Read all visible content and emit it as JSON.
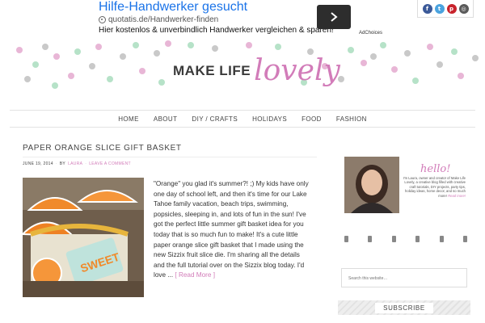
{
  "ad": {
    "title": "Hilfe-Handwerker gesucht",
    "url": "quotatis.de/Handwerker-finden",
    "description": "Hier kostenlos & unverbindlich Handwerker vergleichen & sparen!",
    "adchoices": "AdChoices"
  },
  "social": [
    {
      "icon": "facebook-icon",
      "glyph": "f",
      "color": "#3b5998"
    },
    {
      "icon": "twitter-icon",
      "glyph": "t",
      "color": "#4aa3df"
    },
    {
      "icon": "pinterest-icon",
      "glyph": "p",
      "color": "#c8232c"
    },
    {
      "icon": "instagram-icon",
      "glyph": "◎",
      "color": "#5a5a5a"
    }
  ],
  "logo": {
    "part1": "MAKE LIFE",
    "part2": "lovely"
  },
  "nav": [
    "HOME",
    "ABOUT",
    "DIY / CRAFTS",
    "HOLIDAYS",
    "FOOD",
    "FASHION"
  ],
  "post": {
    "title": "PAPER ORANGE SLICE GIFT BASKET",
    "date": "JUNE 19, 2014",
    "by": "BY",
    "author": "LAURA",
    "comment": "LEAVE A COMMENT",
    "body": "\"Orange\" you glad it's summer?!  ;)  My kids have only one day of school left, and then it's time for our Lake Tahoe family vacation, beach trips, swimming, popsicles, sleeping in, and lots of fun in the sun! I've got the perfect little summer gift basket idea for you today that is so much fun to make!  It's a cute little paper orange slice gift basket that I made using the new Sizzix fruit slice die. I'm sharing all the details and the full tutorial over on the Sizzix blog today.  I'd love ...",
    "read_more": "[ Read More ]",
    "tag_text": "SWEET"
  },
  "sidebar": {
    "hello": "hello!",
    "bio": "I'm Laura, owner and creator of Make Life Lovely, a creative blog filled with creative craft tutorials, DIY projects, party tips, holiday ideas, home decor, and so much more!",
    "bio_sign": "Read more!",
    "search_placeholder": "Search this website…",
    "subscribe": "SUBSCRIBE"
  },
  "colors": {
    "accent": "#d27cb9",
    "link": "#1a73e8"
  }
}
